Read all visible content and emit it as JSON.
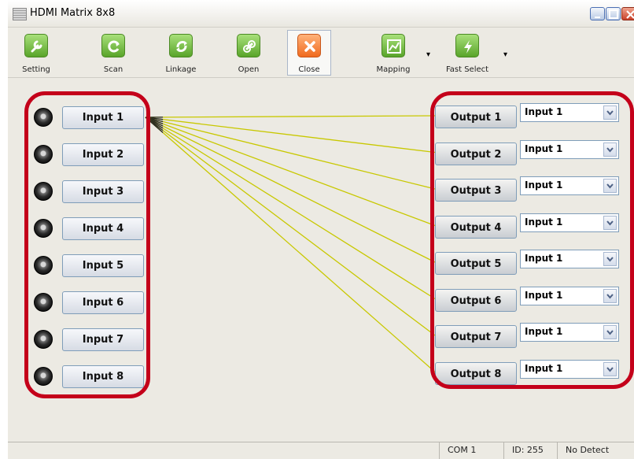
{
  "window": {
    "title": "HDMI Matrix 8x8"
  },
  "toolbar": {
    "setting": "Setting",
    "scan": "Scan",
    "linkage": "Linkage",
    "open": "Open",
    "close": "Close",
    "mapping": "Mapping",
    "fast_select": "Fast Select"
  },
  "inputs": [
    "Input 1",
    "Input 2",
    "Input 3",
    "Input 4",
    "Input 5",
    "Input 6",
    "Input 7",
    "Input 8"
  ],
  "outputs": [
    {
      "label": "Output 1",
      "source": "Input 1"
    },
    {
      "label": "Output 2",
      "source": "Input 1"
    },
    {
      "label": "Output 3",
      "source": "Input 1"
    },
    {
      "label": "Output 4",
      "source": "Input 1"
    },
    {
      "label": "Output 5",
      "source": "Input 1"
    },
    {
      "label": "Output 6",
      "source": "Input 1"
    },
    {
      "label": "Output 7",
      "source": "Input 1"
    },
    {
      "label": "Output 8",
      "source": "Input 1"
    }
  ],
  "status": {
    "port": "COM 1",
    "id": "ID: 255",
    "detect": "No Detect"
  },
  "colors": {
    "wire": "#c8c800",
    "highlight": "#c4001a"
  }
}
